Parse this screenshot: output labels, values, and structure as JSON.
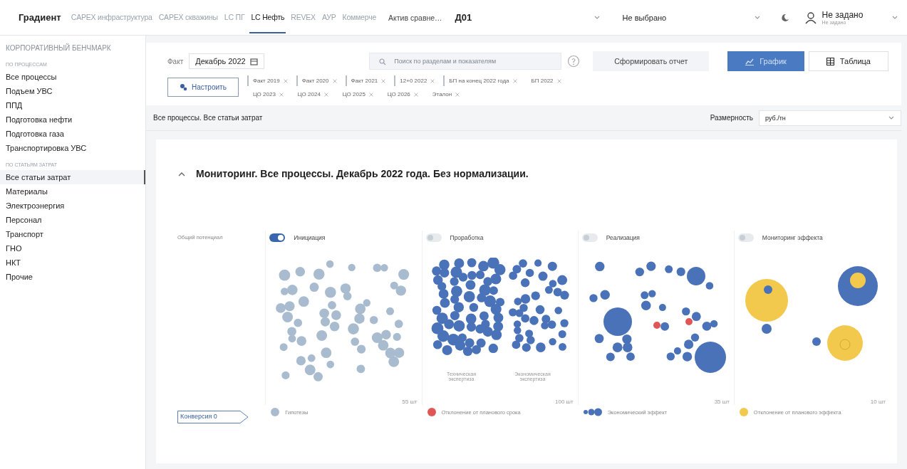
{
  "nav": {
    "brand": "Градиент",
    "tabs": [
      {
        "label": "CAPEX инфраструктура",
        "selected": false
      },
      {
        "label": "CAPEX скважины",
        "selected": false
      },
      {
        "label": "LC ПГ",
        "selected": false
      },
      {
        "label": "LC Нефть",
        "selected": true
      },
      {
        "label": "REVEX",
        "selected": false
      },
      {
        "label": "АУР",
        "selected": false
      },
      {
        "label": "Коммерче",
        "selected": false
      }
    ],
    "asset": "Актив сравне…",
    "asset_value": "Д01",
    "select_value": "Не выбрано",
    "user": {
      "name": "Не задано",
      "role": "Не задано"
    }
  },
  "sidebar": {
    "title": "КОРПОРАТИВНЫЙ БЕНЧМАРК",
    "sections": [
      {
        "heading": "ПО ПРОЦЕССАМ",
        "items": [
          {
            "label": "Все процессы",
            "selected": false
          },
          {
            "label": "Подъем УВС",
            "selected": false
          },
          {
            "label": "ППД",
            "selected": false
          },
          {
            "label": "Подготовка нефти",
            "selected": false
          },
          {
            "label": "Подготовка газа",
            "selected": false
          },
          {
            "label": "Транспортировка УВС",
            "selected": false
          }
        ]
      },
      {
        "heading": "ПО СТАТЬЯМ ЗАТРАТ",
        "items": [
          {
            "label": "Все статьи затрат",
            "selected": true
          },
          {
            "label": "Материалы",
            "selected": false
          },
          {
            "label": "Электроэнергия",
            "selected": false
          },
          {
            "label": "Персонал",
            "selected": false
          },
          {
            "label": "Транспорт",
            "selected": false
          },
          {
            "label": "ГНО",
            "selected": false
          },
          {
            "label": "НКТ",
            "selected": false
          },
          {
            "label": "Прочие",
            "selected": false
          }
        ]
      }
    ]
  },
  "filters": {
    "period_label": "Факт",
    "period_value": "Декабрь 2022",
    "search_placeholder": "Поиск по разделам и показателям",
    "report_button": "Сформировать отчет",
    "views": [
      {
        "label": "График",
        "kind": "chart",
        "selected": true
      },
      {
        "label": "Таблица",
        "kind": "table",
        "selected": false
      }
    ],
    "configure_button": "Настроить",
    "chips": [
      {
        "label": "Факт 2019",
        "marked": true
      },
      {
        "label": "Факт 2020",
        "marked": true
      },
      {
        "label": "Факт 2021",
        "marked": true
      },
      {
        "label": "12+0 2022",
        "marked": true
      },
      {
        "label": "БП на конец 2022 года",
        "marked": true
      },
      {
        "label": "БП 2022",
        "marked": false
      },
      {
        "label": "ЦО 2023",
        "marked": false
      },
      {
        "label": "ЦО 2024",
        "marked": false
      },
      {
        "label": "ЦО 2025",
        "marked": false
      },
      {
        "label": "ЦО 2026",
        "marked": false
      },
      {
        "label": "Эталон",
        "marked": false
      }
    ]
  },
  "breadcrumb": "Все процессы. Все статьи затрат",
  "unit": {
    "label": "Размерность",
    "value": "руб./тн"
  },
  "monitoring": {
    "title": "Мониторинг. Все процессы. Декабрь 2022 года. Без нормализации.",
    "expanded": true,
    "potential_label": "Общий потенциал",
    "stages": [
      {
        "name": "Инициация",
        "on": true,
        "kind": "hypotheses",
        "count": "55 шт"
      },
      {
        "name": "Проработка",
        "on": false,
        "kind": "expertise",
        "count": "100 шт",
        "sublabels": [
          "Техническая экспертиза",
          "Экономическая экспертиза"
        ]
      },
      {
        "name": "Реализация",
        "on": false,
        "kind": "realization",
        "count": "35 шт"
      },
      {
        "name": "Мониторинг эффекта",
        "on": false,
        "kind": "monitoring",
        "count": "10 шт"
      }
    ],
    "conversion": "Конверсия 0",
    "legend": [
      {
        "label": "Гипотезы",
        "kind": "dot",
        "color": "#a9bccf"
      },
      {
        "label": "Отклонение от планового срока",
        "kind": "dot",
        "color": "#e05555"
      },
      {
        "label": "Экономический эффект",
        "kind": "dots",
        "color": "#4a72b8"
      },
      {
        "label": "Отклонение от планового эффекта",
        "kind": "dot",
        "color": "#f2c94c"
      }
    ]
  }
}
